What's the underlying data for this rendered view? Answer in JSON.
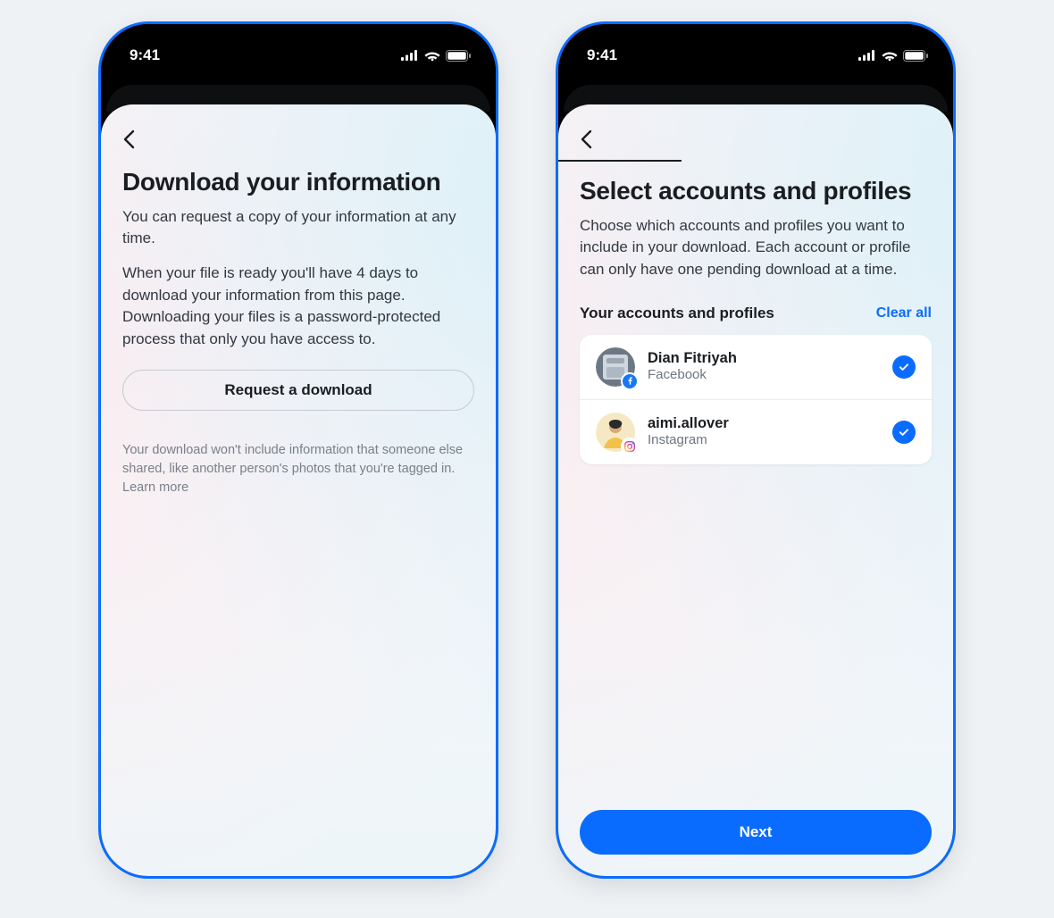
{
  "status": {
    "time": "9:41"
  },
  "screen1": {
    "title": "Download your information",
    "subtext": "You can request a copy of your information at any time.",
    "para2": "When your file is ready you'll have 4 days to download your information from this page. Downloading your files is a password-protected process that only you have access to.",
    "request_label": "Request a download",
    "footnote": "Your download won't include information that someone else shared, like another person's photos that you're tagged in. Learn more"
  },
  "screen2": {
    "title": "Select accounts and profiles",
    "subtext": "Choose which accounts and profiles you want to include in your download. Each account or profile can only have one pending download at a time.",
    "section_label": "Your accounts and profiles",
    "clear_all": "Clear all",
    "accounts": [
      {
        "name": "Dian Fitriyah",
        "platform": "Facebook",
        "selected": true
      },
      {
        "name": "aimi.allover",
        "platform": "Instagram",
        "selected": true
      }
    ],
    "next_label": "Next"
  }
}
